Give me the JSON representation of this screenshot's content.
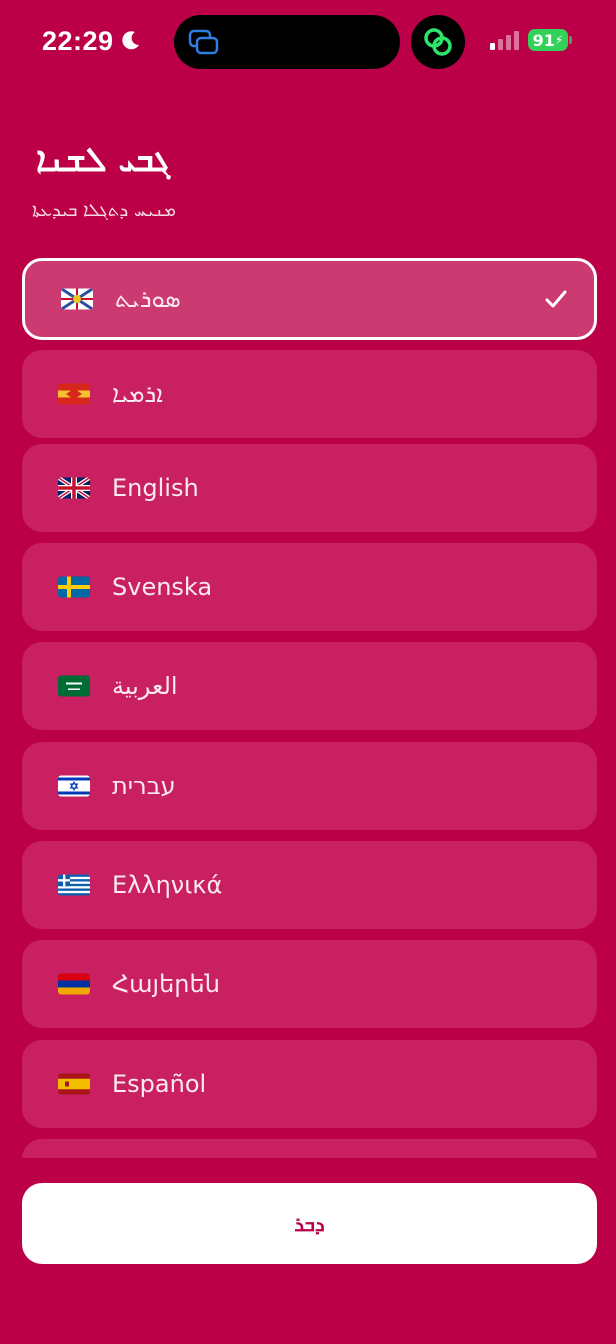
{
  "status_bar": {
    "time": "22:29",
    "battery": "91",
    "icons": [
      "moon-icon",
      "screen-mirror-icon",
      "link-icon",
      "signal-icon",
      "battery-icon"
    ]
  },
  "header": {
    "title": "ܓܒܝ ܠܫܢܐ",
    "subtitle": "ܡܢܝܚ ܕܬܓܠܐ ܒܝܕܥܬܐ"
  },
  "languages": [
    {
      "label": "ܣܘܪܝܬ",
      "flag": "assyrian-flag",
      "selected": true
    },
    {
      "label": "ܐܪܡܝܐ",
      "flag": "aramean-flag",
      "selected": false
    },
    {
      "label": "English",
      "flag": "uk-flag",
      "selected": false
    },
    {
      "label": "Svenska",
      "flag": "sweden-flag",
      "selected": false
    },
    {
      "label": "العربية",
      "flag": "saudi-flag",
      "selected": false
    },
    {
      "label": "עברית",
      "flag": "israel-flag",
      "selected": false
    },
    {
      "label": "Ελληνικά",
      "flag": "greece-flag",
      "selected": false
    },
    {
      "label": "Հայերեն",
      "flag": "armenia-flag",
      "selected": false
    },
    {
      "label": "Español",
      "flag": "spain-flag",
      "selected": false
    }
  ],
  "footer": {
    "next_label": "ܕܒܪ"
  },
  "colors": {
    "background": "#bb0047",
    "item": "#c82060",
    "selected_item": "#cc3a72",
    "button": "#ffffff"
  }
}
